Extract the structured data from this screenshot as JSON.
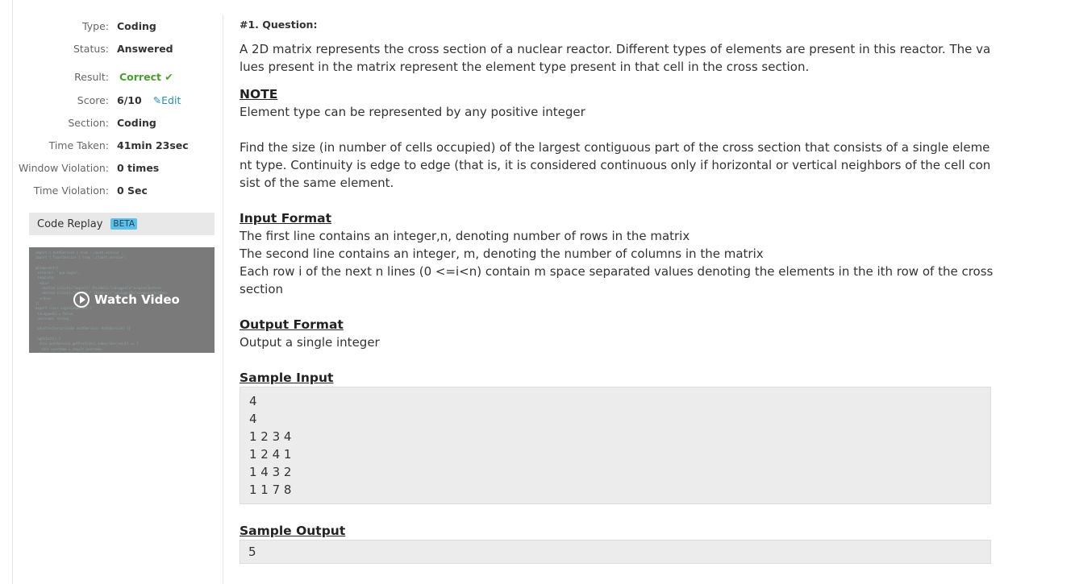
{
  "meta": [
    {
      "label": "Type:",
      "value": "Coding"
    },
    {
      "label": "Status:",
      "value": "Answered"
    },
    {
      "label": "Result:",
      "value": "Correct ✔"
    },
    {
      "label": "Score:",
      "value": "6/10",
      "action": "Edit"
    },
    {
      "label": "Section:",
      "value": "Coding"
    },
    {
      "label": "Time Taken:",
      "value": "41min 23sec"
    },
    {
      "label": "Window Violation:",
      "value": "0 times"
    },
    {
      "label": "Time Violation:",
      "value": "0 Sec"
    }
  ],
  "replay": {
    "title": "Code Replay",
    "badge": "BETA",
    "video_label": "Watch Video"
  },
  "question": {
    "heading": "#1. Question:",
    "intro": "A 2D matrix represents the cross section of a nuclear reactor. Different types of elements are present in this reactor. The values present in the matrix represent the element type present in that cell in the cross section.",
    "note_title": "NOTE",
    "note": "Element type can be represented by any positive integer",
    "task": "Find the size (in number of cells occupied) of the largest contiguous part of the cross section that consists of a single element type. Continuity is edge to edge (that is, it is considered continuous only if horizontal or vertical neighbors of the cell consist of the same element.",
    "input_title": "Input Format",
    "input_lines": [
      "The first line contains an integer,n, denoting number of rows in the matrix",
      "The second line contains an integer, m, denoting the number of columns in the matrix",
      "Each row i of the next n lines (0 <=i<n) contain m space separated values denoting the elements in the ith row of the cross section"
    ],
    "output_title": "Output Format",
    "output": "Output a single integer",
    "sample_input_title": "Sample Input",
    "sample_input": "4\n4\n1 2 3 4\n1 2 4 1\n1 4 3 2\n1 1 7 8",
    "sample_output_title": "Sample Output",
    "sample_output": "5"
  }
}
